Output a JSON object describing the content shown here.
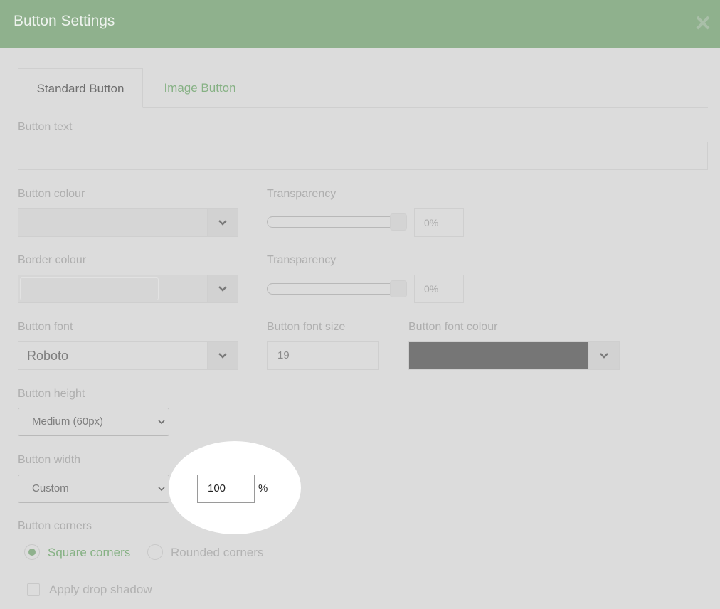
{
  "dialog": {
    "title": "Button Settings",
    "close_icon": "close-icon"
  },
  "tabs": [
    {
      "label": "Standard Button",
      "active": true
    },
    {
      "label": "Image Button",
      "active": false
    }
  ],
  "form": {
    "button_text": {
      "label": "Button text",
      "value": ""
    },
    "button_colour": {
      "label": "Button colour"
    },
    "button_transparency": {
      "label": "Transparency",
      "value": "0%"
    },
    "border_colour": {
      "label": "Border colour"
    },
    "border_transparency": {
      "label": "Transparency",
      "value": "0%"
    },
    "button_font": {
      "label": "Button font",
      "value": "Roboto"
    },
    "button_font_size": {
      "label": "Button font size",
      "value": "19"
    },
    "button_font_colour": {
      "label": "Button font colour",
      "swatch": "#767676"
    },
    "button_height": {
      "label": "Button height",
      "value": "Medium (60px)"
    },
    "button_width": {
      "label": "Button width",
      "value": "Custom",
      "custom_value": "100",
      "unit": "%"
    },
    "button_corners": {
      "label": "Button corners",
      "options": [
        {
          "label": "Square corners",
          "selected": true
        },
        {
          "label": "Rounded corners",
          "selected": false
        }
      ]
    },
    "drop_shadow": {
      "label": "Apply drop shadow",
      "checked": false
    }
  },
  "colors": {
    "accent": "#8fb18d",
    "accent_text": "#86b184",
    "background": "#dcdcdc"
  }
}
